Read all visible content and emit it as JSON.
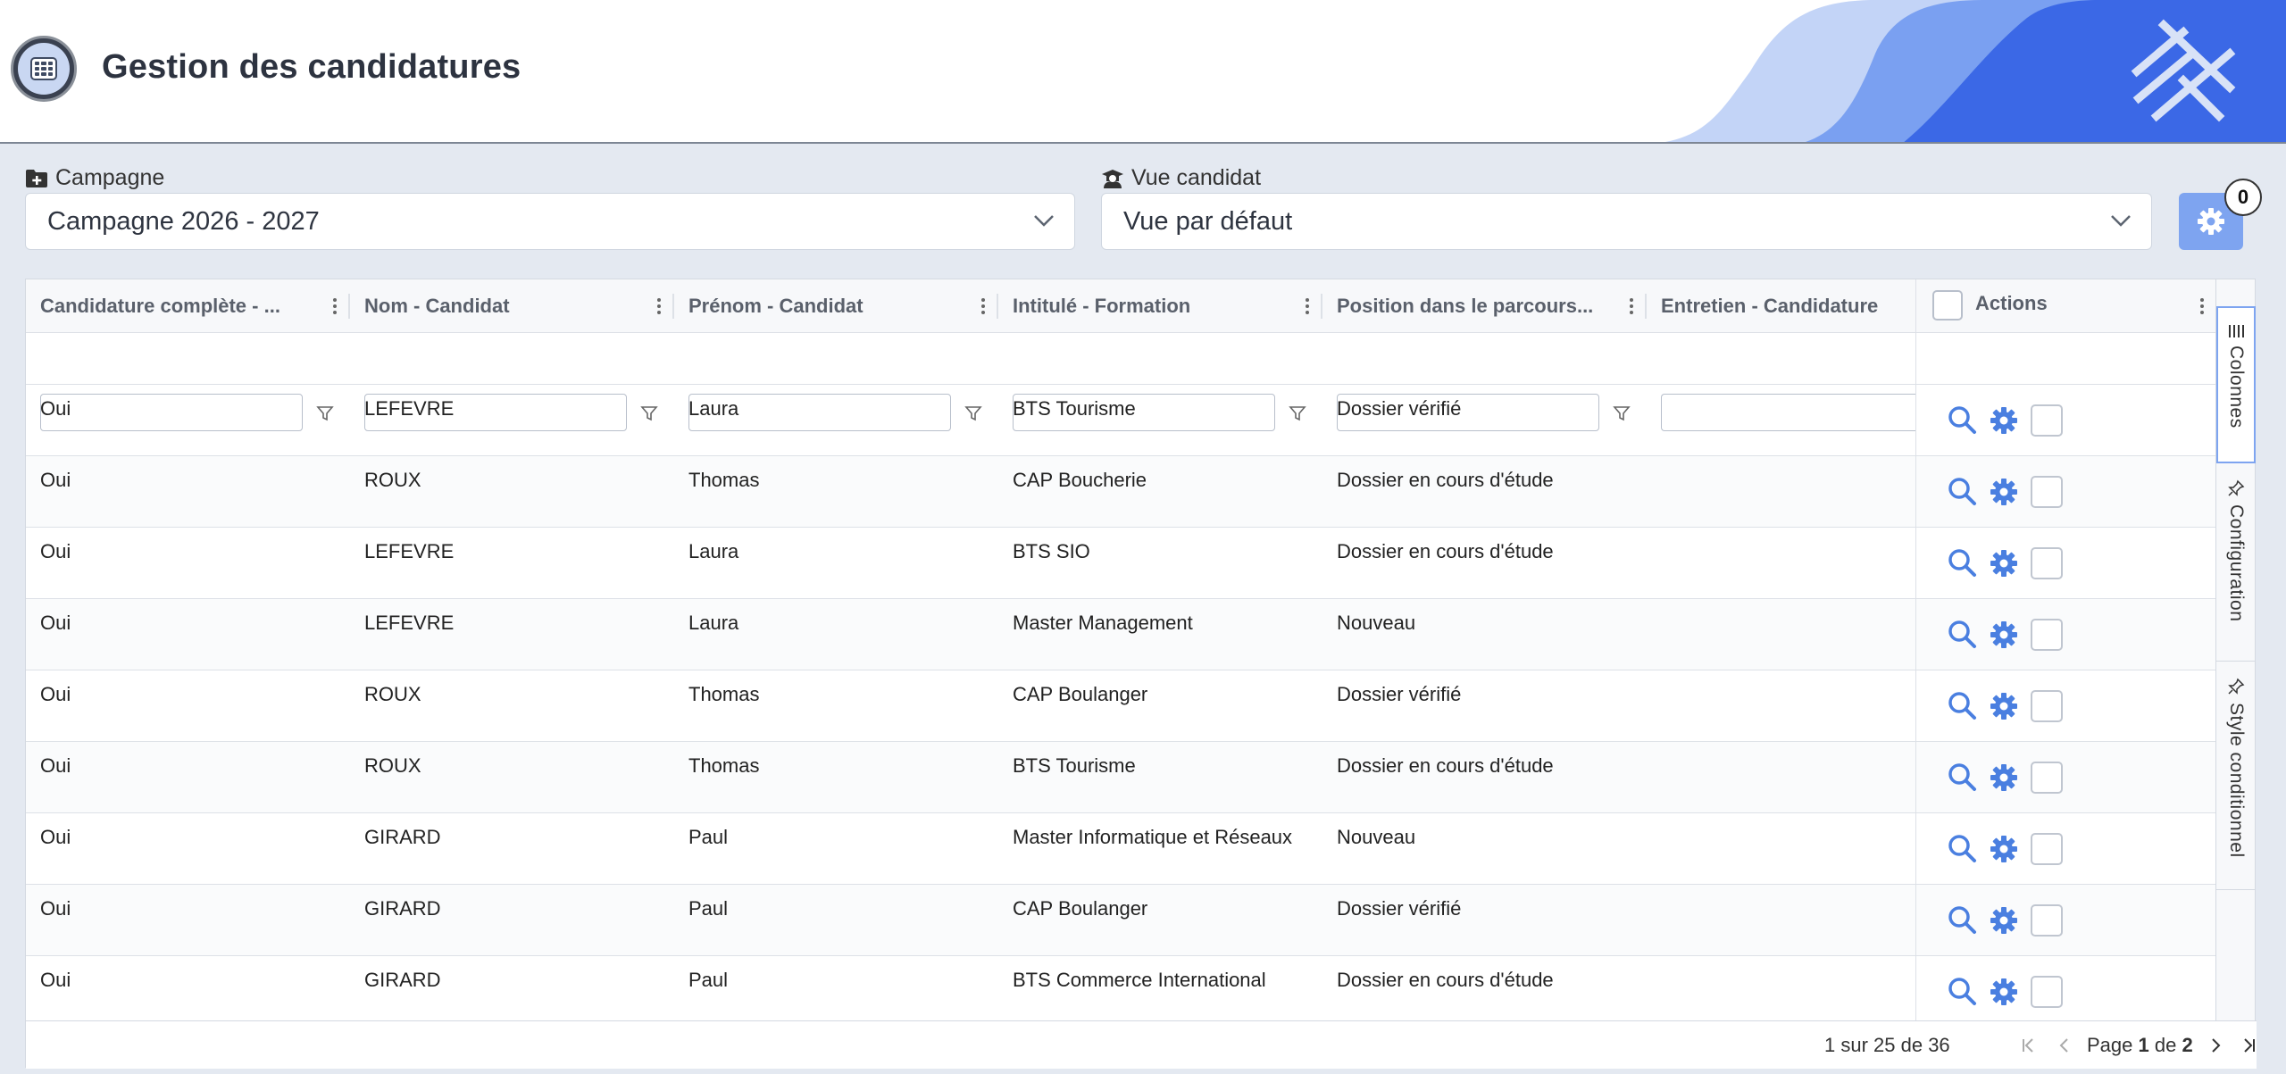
{
  "header": {
    "title": "Gestion des candidatures",
    "app_icon": "app-grid-icon",
    "logo_icon": "cross-logo-icon"
  },
  "campaign": {
    "label": "Campagne",
    "icon": "folder-plus-icon",
    "value": "Campagne 2026 - 2027"
  },
  "view": {
    "label": "Vue candidat",
    "icon": "graduate-icon",
    "value": "Vue par défaut"
  },
  "settings": {
    "icon": "gear-icon",
    "badge": "0"
  },
  "grid": {
    "columns": [
      "Candidature complète - ...",
      "Nom - Candidat",
      "Prénom - Candidat",
      "Intitulé - Formation",
      "Position dans le parcours...",
      "Entretien - Candidature"
    ],
    "actions_label": "Actions",
    "rows": [
      [
        "Oui",
        "LEFEVRE",
        "Laura",
        "BTS Tourisme",
        "Dossier vérifié",
        ""
      ],
      [
        "Oui",
        "ROUX",
        "Thomas",
        "CAP Boucherie",
        "Dossier en cours d'étude",
        ""
      ],
      [
        "Oui",
        "LEFEVRE",
        "Laura",
        "BTS SIO",
        "Dossier en cours d'étude",
        ""
      ],
      [
        "Oui",
        "LEFEVRE",
        "Laura",
        "Master Management",
        "Nouveau",
        ""
      ],
      [
        "Oui",
        "ROUX",
        "Thomas",
        "CAP Boulanger",
        "Dossier vérifié",
        ""
      ],
      [
        "Oui",
        "ROUX",
        "Thomas",
        "BTS Tourisme",
        "Dossier en cours d'étude",
        ""
      ],
      [
        "Oui",
        "GIRARD",
        "Paul",
        "Master Informatique et Réseaux",
        "Nouveau",
        ""
      ],
      [
        "Oui",
        "GIRARD",
        "Paul",
        "CAP Boulanger",
        "Dossier vérifié",
        ""
      ],
      [
        "Oui",
        "GIRARD",
        "Paul",
        "BTS Commerce International",
        "Dossier en cours d'étude",
        ""
      ]
    ]
  },
  "side_panel": {
    "tabs": [
      "Colonnes",
      "Configuration",
      "Style conditionnel"
    ]
  },
  "footer": {
    "count": "1 sur 25 de 36",
    "page_prefix": "Page",
    "page_current": "1",
    "page_sep": "de",
    "page_total": "2"
  },
  "colors": {
    "accent": "#7ea4f0",
    "icon_blue": "#4a7fe0",
    "header_deco_light": "#b9cdf6",
    "header_deco_mid": "#6f99f0",
    "header_deco_dark": "#2f5fe0"
  }
}
